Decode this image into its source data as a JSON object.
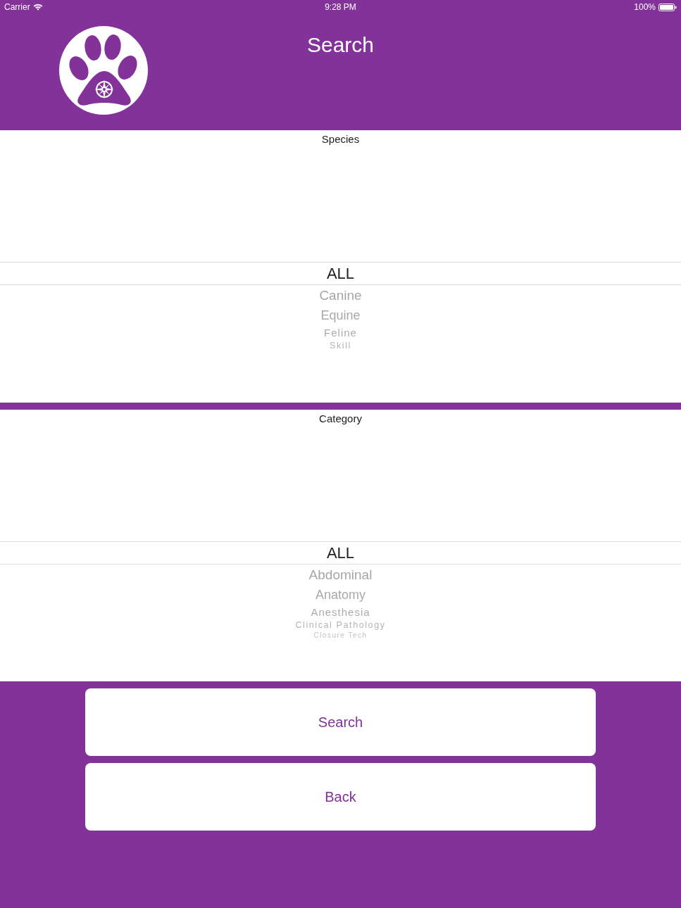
{
  "status_bar": {
    "carrier": "Carrier",
    "time": "9:28 PM",
    "battery": "100%"
  },
  "header": {
    "title": "Search"
  },
  "pickers": [
    {
      "label": "Species",
      "options": [
        {
          "text": "ALL",
          "selected": true
        },
        {
          "text": "Canine",
          "selected": false
        },
        {
          "text": "Equine",
          "selected": false
        },
        {
          "text": "Feline",
          "selected": false
        },
        {
          "text": "Skill",
          "selected": false
        }
      ]
    },
    {
      "label": "Category",
      "options": [
        {
          "text": "ALL",
          "selected": true
        },
        {
          "text": "Abdominal",
          "selected": false
        },
        {
          "text": "Anatomy",
          "selected": false
        },
        {
          "text": "Anesthesia",
          "selected": false
        },
        {
          "text": "Clinical Pathology",
          "selected": false
        },
        {
          "text": "Closure Tech",
          "selected": false
        }
      ]
    }
  ],
  "buttons": [
    "Search",
    "Back"
  ]
}
